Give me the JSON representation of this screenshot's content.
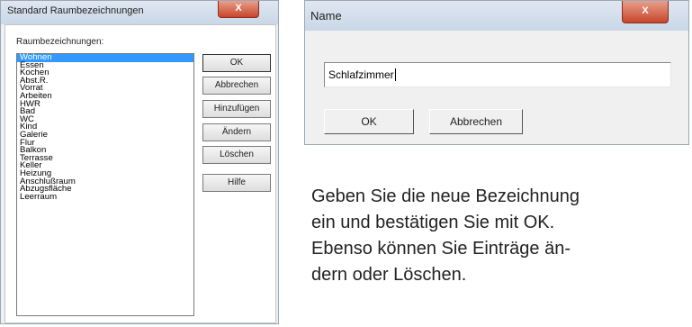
{
  "dialog1": {
    "title": "Standard Raumbezeichnungen",
    "close_glyph": "X",
    "list_label": "Raumbezeichnungen:",
    "items": [
      "Wohnen",
      "Essen",
      "Kochen",
      "Abst.R.",
      "Vorrat",
      "Arbeiten",
      "HWR",
      "Bad",
      "WC",
      "Kind",
      "Galerie",
      "Flur",
      "Balkon",
      "Terrasse",
      "Keller",
      "Heizung",
      "Anschlußraum",
      "Abzugsfläche",
      "Leerraum"
    ],
    "selected_index": 0,
    "buttons": {
      "ok": "OK",
      "cancel": "Abbrechen",
      "add": "Hinzufügen",
      "edit": "Ändern",
      "delete": "Löschen",
      "help": "Hilfe"
    }
  },
  "dialog2": {
    "title": "Name",
    "close_glyph": "X",
    "input_value": "Schlafzimmer",
    "buttons": {
      "ok": "OK",
      "cancel": "Abbrechen"
    }
  },
  "caption": {
    "lines": [
      "Geben Sie die neue Bezeichnung",
      "ein und bestätigen Sie mit OK.",
      "Ebenso können Sie Einträge än-",
      "dern oder Löschen."
    ]
  }
}
